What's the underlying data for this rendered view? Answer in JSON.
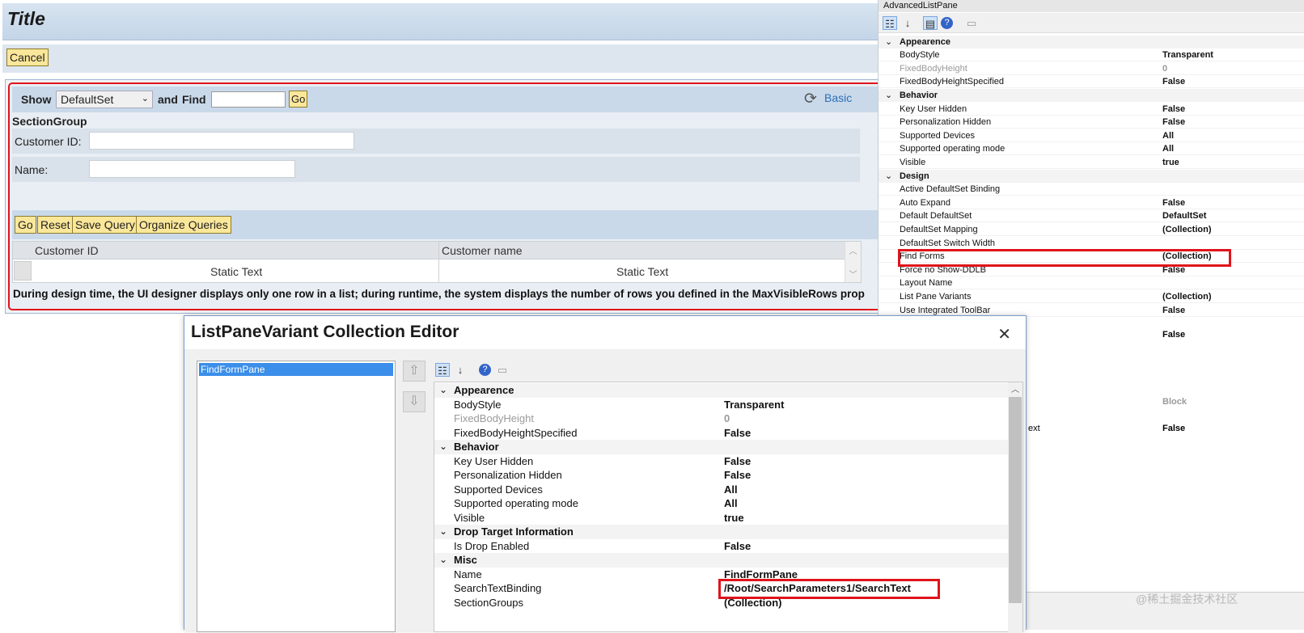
{
  "designer": {
    "title": "Title",
    "cancel_label": "Cancel",
    "find_bar": {
      "show_label": "Show",
      "show_value": "DefaultSet",
      "and_find_label": "and",
      "find_label": "Find",
      "go_label": "Go",
      "basic_label": "Basic"
    },
    "section_group": "SectionGroup",
    "customer_id_label": "Customer ID:",
    "name_label": "Name:",
    "buttons": [
      "Go",
      "Reset",
      "Save Query",
      "Organize Queries"
    ],
    "grid": {
      "headers": [
        "Customer ID",
        "Customer name"
      ],
      "cells": [
        "Static Text",
        "Static Text"
      ]
    },
    "note": "During design time, the UI designer displays only one row in a list; during runtime, the system displays the number of rows you defined in the MaxVisibleRows prop"
  },
  "properties": {
    "title": "AdvancedListPane",
    "categories": [
      {
        "name": "Appearence",
        "rows": [
          {
            "name": "BodyStyle",
            "value": "Transparent"
          },
          {
            "name": "FixedBodyHeight",
            "value": "0",
            "dim": true
          },
          {
            "name": "FixedBodyHeightSpecified",
            "value": "False"
          }
        ]
      },
      {
        "name": "Behavior",
        "rows": [
          {
            "name": "Key User Hidden",
            "value": "False"
          },
          {
            "name": "Personalization Hidden",
            "value": "False"
          },
          {
            "name": "Supported Devices",
            "value": "All"
          },
          {
            "name": "Supported operating mode",
            "value": "All"
          },
          {
            "name": "Visible",
            "value": "true"
          }
        ]
      },
      {
        "name": "Design",
        "rows": [
          {
            "name": "Active DefaultSet Binding",
            "value": ""
          },
          {
            "name": "Auto Expand",
            "value": "False"
          },
          {
            "name": "Default DefaultSet",
            "value": "DefaultSet"
          },
          {
            "name": "DefaultSet Mapping",
            "value": "(Collection)"
          },
          {
            "name": "DefaultSet Switch Width",
            "value": ""
          },
          {
            "name": "Find Forms",
            "value": "(Collection)"
          },
          {
            "name": "Force no Show-DDLB",
            "value": "False"
          },
          {
            "name": "Layout Name",
            "value": ""
          },
          {
            "name": "List Pane Variants",
            "value": "(Collection)"
          },
          {
            "name": "Use Integrated ToolBar",
            "value": "False"
          }
        ]
      }
    ],
    "hidden_values": [
      "False",
      "Block",
      "ext",
      "False"
    ]
  },
  "dialog": {
    "title": "ListPaneVariant Collection Editor",
    "close_label": "✕",
    "members": [
      "FindFormPane"
    ],
    "up_label": "⇧",
    "down_label": "⇩",
    "categories": [
      {
        "name": "Appearence",
        "rows": [
          {
            "name": "BodyStyle",
            "value": "Transparent"
          },
          {
            "name": "FixedBodyHeight",
            "value": "0",
            "dim": true
          },
          {
            "name": "FixedBodyHeightSpecified",
            "value": "False"
          }
        ]
      },
      {
        "name": "Behavior",
        "rows": [
          {
            "name": "Key User Hidden",
            "value": "False"
          },
          {
            "name": "Personalization Hidden",
            "value": "False"
          },
          {
            "name": "Supported Devices",
            "value": "All"
          },
          {
            "name": "Supported operating mode",
            "value": "All"
          },
          {
            "name": "Visible",
            "value": "true"
          }
        ]
      },
      {
        "name": "Drop Target Information",
        "rows": [
          {
            "name": "Is Drop Enabled",
            "value": "False"
          }
        ]
      },
      {
        "name": "Misc",
        "rows": [
          {
            "name": "Name",
            "value": "FindFormPane"
          },
          {
            "name": "SearchTextBinding",
            "value": "/Root/SearchParameters1/SearchText"
          },
          {
            "name": "SectionGroups",
            "value": "(Collection)"
          }
        ]
      }
    ]
  },
  "watermark": "@稀土掘金技术社区",
  "colors": {
    "highlight_red": "#e0141b",
    "sap_button": "#fbe79a",
    "selection_blue": "#3b8ee9"
  }
}
